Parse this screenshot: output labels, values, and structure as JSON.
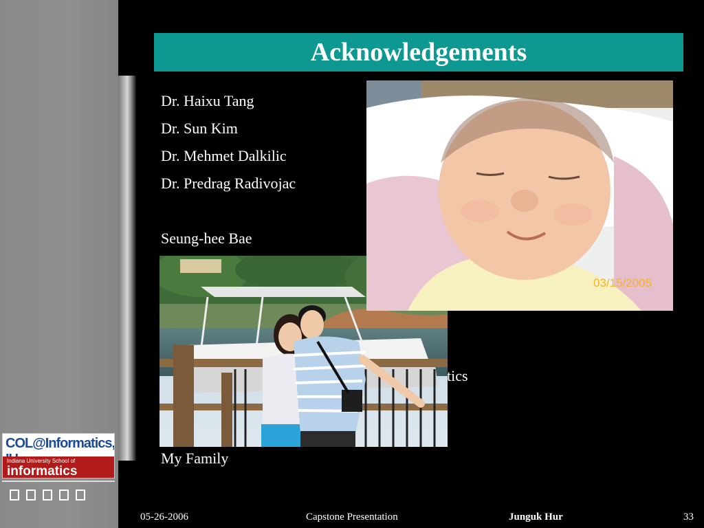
{
  "slide": {
    "title": "Acknowledgements",
    "lines": [
      "Dr. Haixu Tang",
      "Dr. Sun Kim",
      "Dr. Mehmet Dalkilic",
      "Dr. Predrag Radivojac",
      "Seung-hee Bae",
      "tics",
      "My Family"
    ],
    "baby_photo_date": "03/15/2005"
  },
  "logo": {
    "top_text": "COL@Informatics, IU",
    "small_text": "Indiana University School of",
    "main_text": "informatics"
  },
  "footer": {
    "date": "05-26-2006",
    "presentation": "Capstone Presentation",
    "author": "Junguk Hur",
    "page": "33"
  },
  "colors": {
    "title_bar": "#0d9891",
    "sidebar": "#8a8a8a",
    "background": "#000000"
  }
}
